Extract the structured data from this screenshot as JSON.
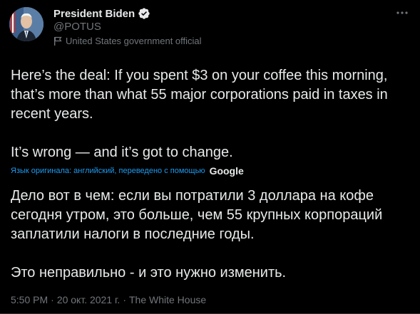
{
  "author": {
    "display_name": "President Biden",
    "handle": "@POTUS",
    "affiliation": "United States government official",
    "verified_icon": "verified-badge-icon",
    "affiliation_icon": "flag-icon"
  },
  "more_icon": "more-horizontal-icon",
  "tweet": {
    "original_text": "Here’s the deal: If you spent $3 on your coffee this morning, that’s more than what 55 major corporations paid in taxes in recent years.\n\nIt’s wrong — and it’s got to change.",
    "translation_note": "Язык оригинала: английский, переведено с помощью",
    "translation_provider": "Google",
    "translated_text": "Дело вот в чем: если вы потратили 3 доллара на кофе сегодня утром, это больше, чем 55 крупных корпораций заплатили налоги в последние годы.\n\n Это неправильно - и это нужно изменить."
  },
  "meta": {
    "time": "5:50 PM",
    "separator": "·",
    "date": "20 окт. 2021 г.",
    "source": "The White House"
  },
  "colors": {
    "background": "#000000",
    "text_primary": "#e7e9ea",
    "text_secondary": "#71767b",
    "link": "#1d9bf0",
    "verified": "#1d9bf0"
  }
}
